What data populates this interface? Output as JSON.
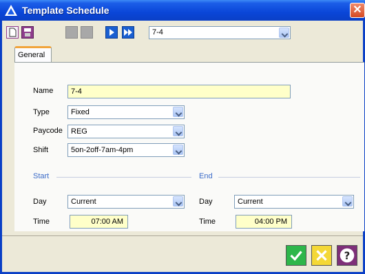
{
  "window": {
    "title": "Template Schedule",
    "close_glyph": "✕"
  },
  "toolbar": {
    "icons": [
      "new-icon",
      "save-icon",
      "disabled-icon",
      "disabled-icon",
      "next-icon",
      "last-icon"
    ],
    "selector_value": "7-4"
  },
  "tabs": [
    {
      "label": "General"
    }
  ],
  "form": {
    "name": {
      "label": "Name",
      "value": "7-4"
    },
    "type": {
      "label": "Type",
      "value": "Fixed"
    },
    "paycode": {
      "label": "Paycode",
      "value": "REG"
    },
    "shift": {
      "label": "Shift",
      "value": "5on-2off-7am-4pm"
    },
    "start": {
      "section": "Start",
      "day_label": "Day",
      "day_value": "Current",
      "time_label": "Time",
      "time_value": "07:00 AM"
    },
    "end": {
      "section": "End",
      "day_label": "Day",
      "day_value": "Current",
      "time_label": "Time",
      "time_value": "04:00 PM"
    }
  },
  "actions": {
    "ok": "check-icon",
    "cancel": "cancel-x-icon",
    "help": "question-icon"
  },
  "colors": {
    "title_bar": "#0a46d8",
    "tab_accent": "#f1a43b",
    "field_highlight": "#ffffc9",
    "section_text": "#3a6ac8"
  }
}
